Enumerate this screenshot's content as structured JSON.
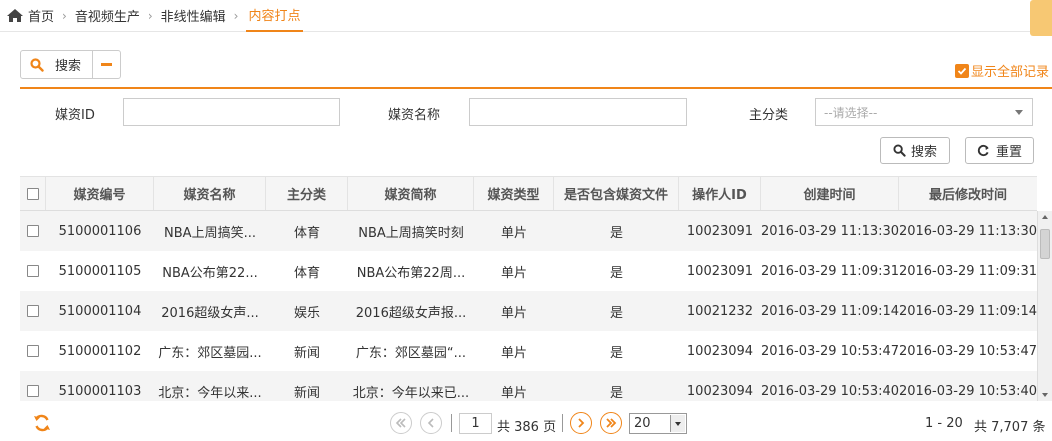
{
  "breadcrumb": {
    "items": [
      "首页",
      "音视频生产",
      "非线性编辑",
      "内容打点"
    ],
    "active_index": 3
  },
  "toolbar": {
    "search_label": "搜索",
    "show_all_label": "显示全部记录",
    "show_all_checked": true
  },
  "filters": {
    "media_id_label": "媒资ID",
    "media_id_value": "",
    "media_name_label": "媒资名称",
    "media_name_value": "",
    "category_label": "主分类",
    "category_placeholder": "--请选择--",
    "search_button": "搜索",
    "reset_button": "重置"
  },
  "table": {
    "headers": [
      "媒资编号",
      "媒资名称",
      "主分类",
      "媒资简称",
      "媒资类型",
      "是否包含媒资文件",
      "操作人ID",
      "创建时间",
      "最后修改时间"
    ],
    "rows": [
      [
        "5100001106",
        "NBA上周搞笑...",
        "体育",
        "NBA上周搞笑时刻",
        "单片",
        "是",
        "10023091",
        "2016-03-29 11:13:30",
        "2016-03-29 11:13:30"
      ],
      [
        "5100001105",
        "NBA公布第22...",
        "体育",
        "NBA公布第22周...",
        "单片",
        "是",
        "10023091",
        "2016-03-29 11:09:31",
        "2016-03-29 11:09:31"
      ],
      [
        "5100001104",
        "2016超级女声...",
        "娱乐",
        "2016超级女声报...",
        "单片",
        "是",
        "10021232",
        "2016-03-29 11:09:14",
        "2016-03-29 11:09:14"
      ],
      [
        "5100001102",
        "广东：郊区墓园...",
        "新闻",
        "广东：郊区墓园“...",
        "单片",
        "是",
        "10023094",
        "2016-03-29 10:53:47",
        "2016-03-29 10:53:47"
      ],
      [
        "5100001103",
        "北京：今年以来...",
        "新闻",
        "北京：今年以来已...",
        "单片",
        "是",
        "10023094",
        "2016-03-29 10:53:40",
        "2016-03-29 10:53:40"
      ]
    ]
  },
  "pagination": {
    "current_page": "1",
    "total_pages_text": "共 386 页",
    "page_size": "20",
    "range_text": "1 - 20",
    "total_text": "共 7,707 条"
  },
  "colors": {
    "accent": "#f08519"
  }
}
